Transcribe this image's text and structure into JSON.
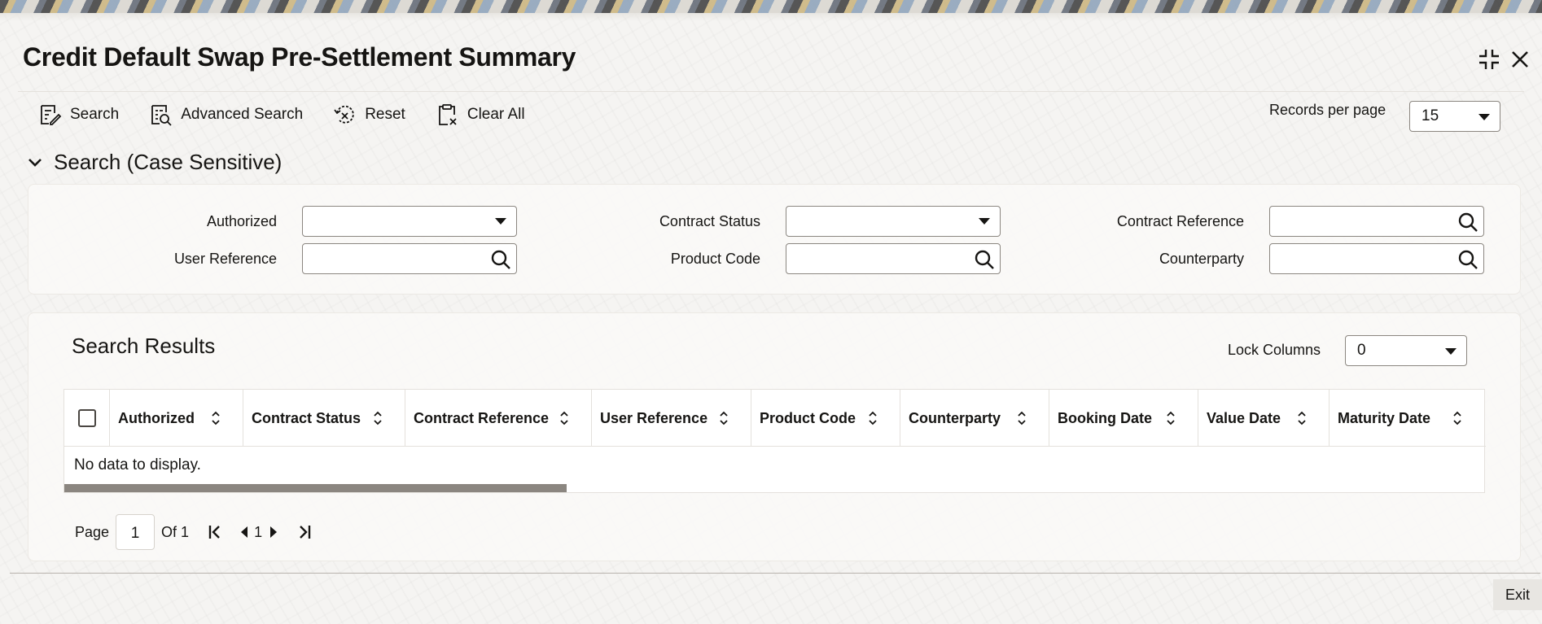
{
  "page": {
    "title": "Credit Default Swap Pre-Settlement Summary"
  },
  "toolbar": {
    "search": "Search",
    "advanced_search": "Advanced Search",
    "reset": "Reset",
    "clear_all": "Clear All"
  },
  "records_per_page": {
    "label": "Records per page",
    "value": "15"
  },
  "search_section": {
    "title": "Search (Case Sensitive)",
    "fields": {
      "authorized": {
        "label": "Authorized",
        "value": ""
      },
      "contract_status": {
        "label": "Contract Status",
        "value": ""
      },
      "contract_reference": {
        "label": "Contract Reference",
        "value": ""
      },
      "user_reference": {
        "label": "User Reference",
        "value": ""
      },
      "product_code": {
        "label": "Product Code",
        "value": ""
      },
      "counterparty": {
        "label": "Counterparty",
        "value": ""
      }
    }
  },
  "results": {
    "title": "Search Results",
    "lock_columns": {
      "label": "Lock Columns",
      "value": "0"
    },
    "columns": [
      "Authorized",
      "Contract Status",
      "Contract Reference",
      "User Reference",
      "Product Code",
      "Counterparty",
      "Booking Date",
      "Value Date",
      "Maturity Date"
    ],
    "empty_message": "No data to display."
  },
  "pager": {
    "page_label": "Page",
    "current": "1",
    "of_label": "Of 1",
    "page_number": "1"
  },
  "footer": {
    "exit": "Exit"
  },
  "icons": {
    "window_controls": [
      "shrink-icon",
      "close-icon"
    ],
    "search_field": "magnifier-icon"
  }
}
